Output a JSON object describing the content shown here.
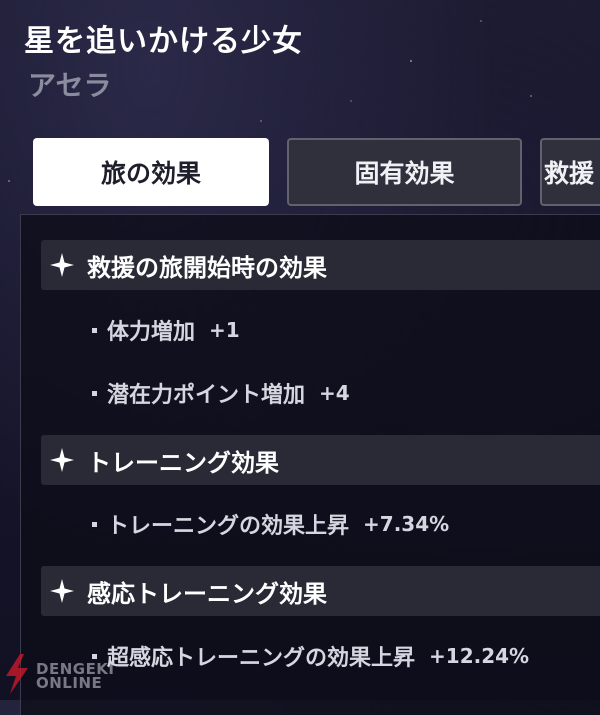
{
  "header": {
    "title": "星を追いかける少女",
    "subtitle": "アセラ"
  },
  "tabs": [
    {
      "label": "旅の効果",
      "active": true
    },
    {
      "label": "固有効果",
      "active": false
    },
    {
      "label": "救援",
      "active": false
    }
  ],
  "sections": [
    {
      "icon": "sparkle-icon",
      "title": "救援の旅開始時の効果",
      "effects": [
        {
          "name": "体力増加",
          "value": "+1"
        },
        {
          "name": "潜在力ポイント増加",
          "value": "+4"
        }
      ]
    },
    {
      "icon": "sparkle-icon",
      "title": "トレーニング効果",
      "effects": [
        {
          "name": "トレーニングの効果上昇",
          "value": "+7.34%"
        }
      ]
    },
    {
      "icon": "sparkle-icon",
      "title": "感応トレーニング効果",
      "effects": [
        {
          "name": "超感応トレーニングの効果上昇",
          "value": "+12.24%"
        }
      ]
    }
  ],
  "watermark": {
    "line1": "DENGEKI",
    "line2": "ONLINE"
  },
  "colors": {
    "active_tab_bg": "#ffffff",
    "inactive_tab_bg": "#30303d",
    "section_header_bg": "#2a2a37",
    "panel_bg": "#0d0d18",
    "title_text": "#ffffff",
    "subtitle_text": "#8c8ca0"
  }
}
